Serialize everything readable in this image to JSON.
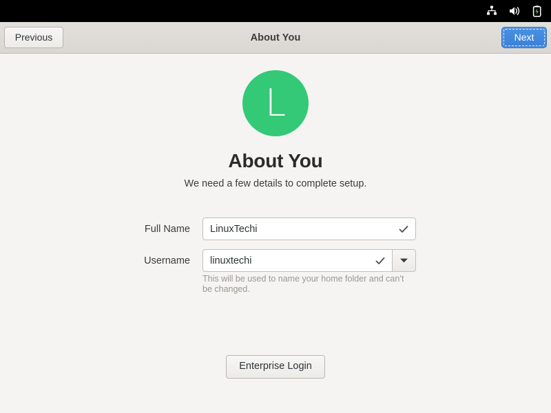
{
  "topbar": {
    "icons": [
      {
        "name": "network-wired-icon",
        "label": "Wired Network"
      },
      {
        "name": "volume-speaker-icon",
        "label": "Volume"
      },
      {
        "name": "battery-charging-icon",
        "label": "Battery Charging"
      }
    ]
  },
  "header": {
    "title": "About You",
    "previous_label": "Previous",
    "next_label": "Next"
  },
  "hero": {
    "avatar_initial": "L",
    "avatar_color": "#33c977",
    "title": "About You",
    "subtitle": "We need a few details to complete setup."
  },
  "form": {
    "fields": [
      {
        "label": "Full Name",
        "value": "LinuxTechi",
        "placeholder": "",
        "valid": true,
        "has_dropdown": false
      },
      {
        "label": "Username",
        "value": "linuxtechi",
        "placeholder": "",
        "valid": true,
        "has_dropdown": true
      }
    ],
    "hint": "This will be used to name your home folder and can’t be changed."
  },
  "footer": {
    "enterprise_label": "Enterprise Login"
  },
  "colors": {
    "accent_blue": "#3a80d8",
    "avatar_green": "#33c977",
    "headerbar": "#dad7d2",
    "page_background": "#f5f4f2",
    "topbar": "#000000",
    "hint_text": "#9b9792"
  }
}
